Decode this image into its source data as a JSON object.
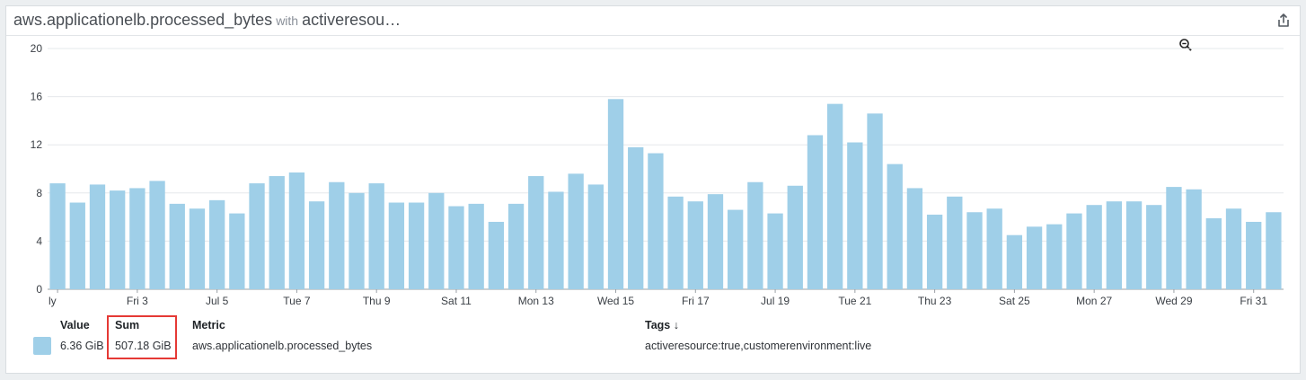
{
  "widget": {
    "metric_title": "aws.applicationelb.processed_bytes",
    "with_text": "with",
    "filter_title": "activeresou…",
    "share_icon": "share-icon",
    "zoom_icon": "zoom-out-icon"
  },
  "legend": {
    "headers": {
      "value": "Value",
      "sum": "Sum",
      "metric": "Metric",
      "tags": "Tags ↓"
    },
    "row": {
      "color": "#9fcfe8",
      "value": "6.36 GiB",
      "sum": "507.18 GiB",
      "metric": "aws.applicationelb.processed_bytes",
      "tags": "activeresource:true,customerenvironment:live"
    },
    "highlight_color": "#e53935"
  },
  "chart_data": {
    "type": "bar",
    "ylim": [
      0,
      20
    ],
    "yticks": [
      0,
      4,
      8,
      12,
      16,
      20
    ],
    "grid": true,
    "bar_color": "#9fcfe8",
    "x_tick_labels": [
      {
        "index": 0,
        "label": "ly"
      },
      {
        "index": 4,
        "label": "Fri 3"
      },
      {
        "index": 8,
        "label": "Jul 5"
      },
      {
        "index": 12,
        "label": "Tue 7"
      },
      {
        "index": 16,
        "label": "Thu 9"
      },
      {
        "index": 20,
        "label": "Sat 11"
      },
      {
        "index": 24,
        "label": "Mon 13"
      },
      {
        "index": 28,
        "label": "Wed 15"
      },
      {
        "index": 32,
        "label": "Fri 17"
      },
      {
        "index": 36,
        "label": "Jul 19"
      },
      {
        "index": 40,
        "label": "Tue 21"
      },
      {
        "index": 44,
        "label": "Thu 23"
      },
      {
        "index": 48,
        "label": "Sat 25"
      },
      {
        "index": 52,
        "label": "Mon 27"
      },
      {
        "index": 56,
        "label": "Wed 29"
      },
      {
        "index": 60,
        "label": "Fri 31"
      }
    ],
    "values": [
      8.8,
      7.2,
      8.7,
      8.2,
      8.4,
      9.0,
      7.1,
      6.7,
      7.4,
      6.3,
      8.8,
      9.4,
      9.7,
      7.3,
      8.9,
      8.0,
      8.8,
      7.2,
      7.2,
      8.0,
      6.9,
      7.1,
      5.6,
      7.1,
      9.4,
      8.1,
      9.6,
      8.7,
      15.8,
      11.8,
      11.3,
      7.7,
      7.3,
      7.9,
      6.6,
      8.9,
      6.3,
      8.6,
      12.8,
      15.4,
      12.2,
      14.6,
      10.4,
      8.4,
      6.2,
      7.7,
      6.4,
      6.7,
      4.5,
      5.2,
      5.4,
      6.3,
      7.0,
      7.3,
      7.3,
      7.0,
      8.5,
      8.3,
      5.9,
      6.7,
      5.6,
      6.4
    ]
  }
}
